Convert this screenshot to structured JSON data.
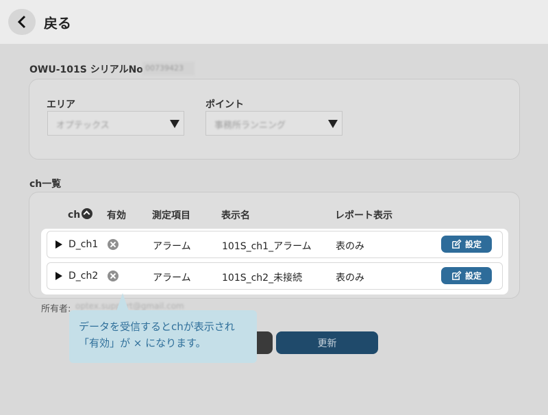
{
  "header": {
    "back_label": "戻る"
  },
  "serial": {
    "label": "OWU-101S シリアルNo.:",
    "value": "00739423"
  },
  "filters": {
    "area": {
      "label": "エリア",
      "value": "オプテックス"
    },
    "point": {
      "label": "ポイント",
      "value": "事務所ランニング"
    }
  },
  "ch_list": {
    "title": "ch一覧",
    "columns": {
      "ch": "ch",
      "enabled": "有効",
      "item": "測定項目",
      "name": "表示名",
      "report": "レポート表示"
    },
    "rows": [
      {
        "ch": "D_ch1",
        "item": "アラーム",
        "name": "101S_ch1_アラーム",
        "report": "表のみ",
        "button": "設定"
      },
      {
        "ch": "D_ch2",
        "item": "アラーム",
        "name": "101S_ch2_未接続",
        "report": "表のみ",
        "button": "設定"
      }
    ]
  },
  "owner": {
    "label": "所有者:",
    "value": "optex.support@gmail.com"
  },
  "actions": {
    "update_label": "更新"
  },
  "callout": {
    "line1": "データを受信するとchが表示され",
    "line2": "「有効」が × になります。"
  }
}
